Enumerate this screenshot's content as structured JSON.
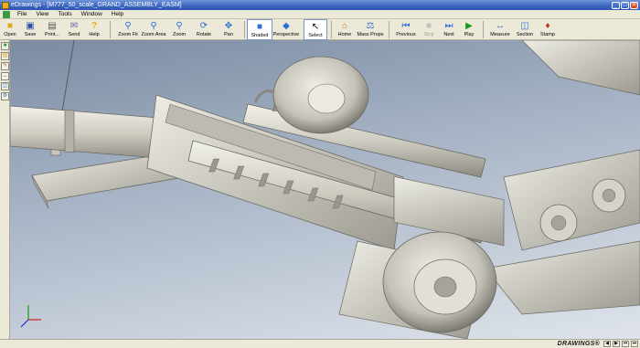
{
  "window": {
    "title": "eDrawings - [M777_50_scale_GRAND_ASSEMBLY_EASM]",
    "controls": [
      "_",
      "□",
      "×"
    ]
  },
  "menu": {
    "items": [
      "File",
      "View",
      "Tools",
      "Window",
      "Help"
    ]
  },
  "toolbar": {
    "buttons": [
      {
        "label": "Open",
        "icon": "folder-open-icon"
      },
      {
        "label": "Save",
        "icon": "save-icon"
      },
      {
        "label": "Print...",
        "icon": "print-icon"
      },
      {
        "label": "Send",
        "icon": "send-icon"
      },
      {
        "label": "Help",
        "icon": "help-icon"
      },
      {
        "label": "Zoom Fit",
        "icon": "zoom-fit-icon"
      },
      {
        "label": "Zoom Area",
        "icon": "zoom-area-icon"
      },
      {
        "label": "Zoom",
        "icon": "zoom-icon"
      },
      {
        "label": "Rotate",
        "icon": "rotate-icon"
      },
      {
        "label": "Pan",
        "icon": "pan-icon"
      },
      {
        "label": "Shaded",
        "icon": "shaded-icon"
      },
      {
        "label": "Perspective",
        "icon": "perspective-icon"
      },
      {
        "label": "Select",
        "icon": "select-arrow-icon"
      },
      {
        "label": "Home",
        "icon": "home-icon"
      },
      {
        "label": "Mass Props",
        "icon": "mass-props-icon"
      },
      {
        "label": "Previous",
        "icon": "previous-icon"
      },
      {
        "label": "Stop",
        "icon": "stop-icon"
      },
      {
        "label": "Next",
        "icon": "next-icon"
      },
      {
        "label": "Play",
        "icon": "play-icon"
      },
      {
        "label": "Measure",
        "icon": "measure-icon"
      },
      {
        "label": "Section",
        "icon": "section-icon"
      },
      {
        "label": "Stamp",
        "icon": "stamp-icon"
      }
    ]
  },
  "status": {
    "brand": "DRAWINGS®"
  },
  "colors": {
    "title_bar": "#3a64c0",
    "accent": "#2d6fd0",
    "play": "#1a9a1a",
    "stop": "#c0c0c0",
    "model": "#d9d7cc"
  }
}
